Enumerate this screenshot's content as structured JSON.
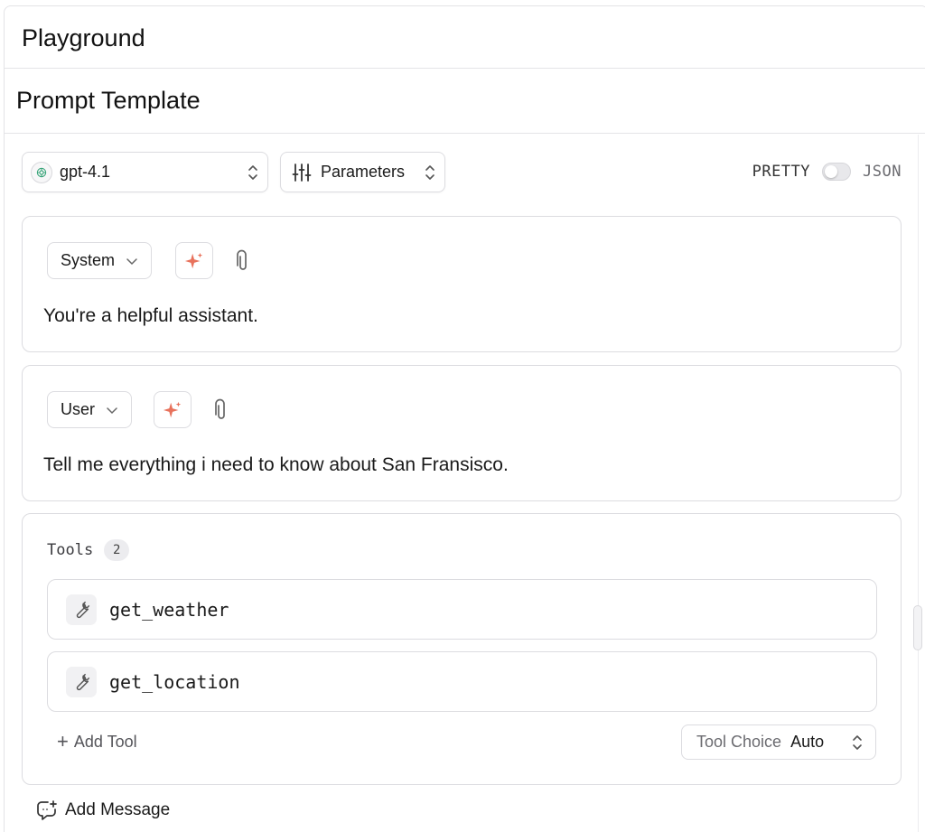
{
  "header": {
    "title": "Playground"
  },
  "subheader": {
    "title": "Prompt Template"
  },
  "toolbar": {
    "model": "gpt-4.1",
    "parameters_label": "Parameters",
    "format_left": "PRETTY",
    "format_right": "JSON",
    "format_toggle_on": false
  },
  "messages": [
    {
      "role": "System",
      "text": "You're a helpful assistant."
    },
    {
      "role": "User",
      "text": "Tell me everything i need to know about San Fransisco."
    }
  ],
  "tools": {
    "label": "Tools",
    "count": "2",
    "items": [
      {
        "name": "get_weather"
      },
      {
        "name": "get_location"
      }
    ],
    "add_label": "Add Tool",
    "choice_key": "Tool Choice",
    "choice_value": "Auto"
  },
  "add_message_label": "Add Message",
  "colors": {
    "sparkle": "#e8725c",
    "border": "#dcdce0",
    "text": "#1a1a1a"
  }
}
